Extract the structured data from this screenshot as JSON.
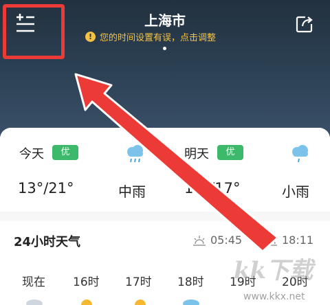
{
  "header": {
    "city": "上海市",
    "time_warning": "您的时间设置有误，点击调整",
    "menu_icon": "menu-add-icon",
    "share_icon": "share-icon"
  },
  "forecast": {
    "today": {
      "label": "今天",
      "aqi": "优",
      "temp": "13°/21°",
      "condition": "中雨",
      "icon": "rain-cloud-icon"
    },
    "tomorrow": {
      "label": "明天",
      "aqi": "优",
      "temp": "10°/17°",
      "condition": "小雨",
      "icon": "rain-cloud-icon"
    }
  },
  "hourly": {
    "title": "24小时天气",
    "sunrise": "05:45",
    "sunset": "18:11",
    "hours": [
      "现在",
      "16时",
      "17时",
      "18时",
      "19时",
      "20时"
    ]
  },
  "watermark": {
    "text": "kk下载",
    "url": "www.kkx.net"
  },
  "colors": {
    "header_bg": "#22313f",
    "warning": "#f3c244",
    "badge": "#3cb96a",
    "annotation_red": "#ec3a37"
  }
}
